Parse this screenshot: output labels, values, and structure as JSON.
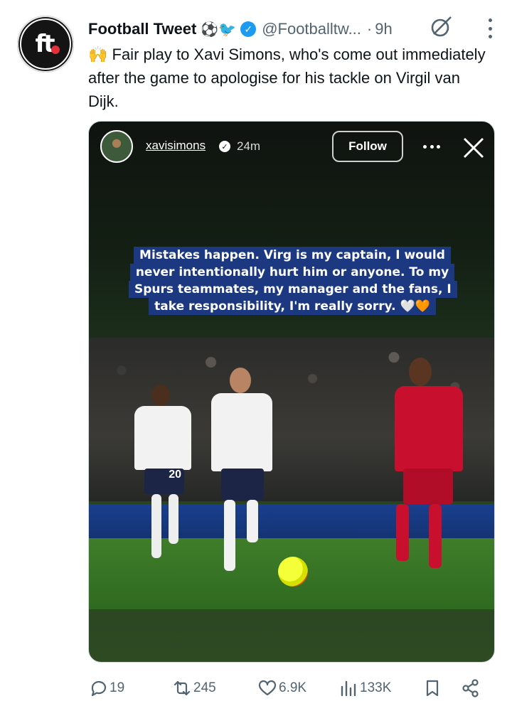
{
  "author": {
    "name": "Football Tweet",
    "badges": "⚽🐦",
    "handle": "@Footballtw...",
    "separator": "·",
    "time": "9h"
  },
  "tweet": {
    "text": "🙌 Fair play to Xavi Simons, who's come out immediately after the game to apologise for his tackle on Virgil van Dijk."
  },
  "story": {
    "username": "xavisimons",
    "time": "24m",
    "follow_label": "Follow",
    "caption": "Mistakes happen. Virg is my captain, I would never intentionally hurt him or anyone. To my Spurs teammates, my manager and the fans, I take responsibility, I'm really sorry. 🤍🧡",
    "kit_number": "20"
  },
  "actions": {
    "replies": "19",
    "reposts": "245",
    "likes": "6.9K",
    "views": "133K"
  },
  "icons": {
    "verified": "verified-check-icon",
    "grok": "grok-icon",
    "more": "more-vertical-icon",
    "reply": "reply-icon",
    "repost": "repost-icon",
    "like": "heart-icon",
    "views": "views-icon",
    "bookmark": "bookmark-icon",
    "share": "share-icon"
  },
  "colors": {
    "accent": "#1d9bf0",
    "muted": "#536471",
    "caption_bg": "#1b3880"
  }
}
